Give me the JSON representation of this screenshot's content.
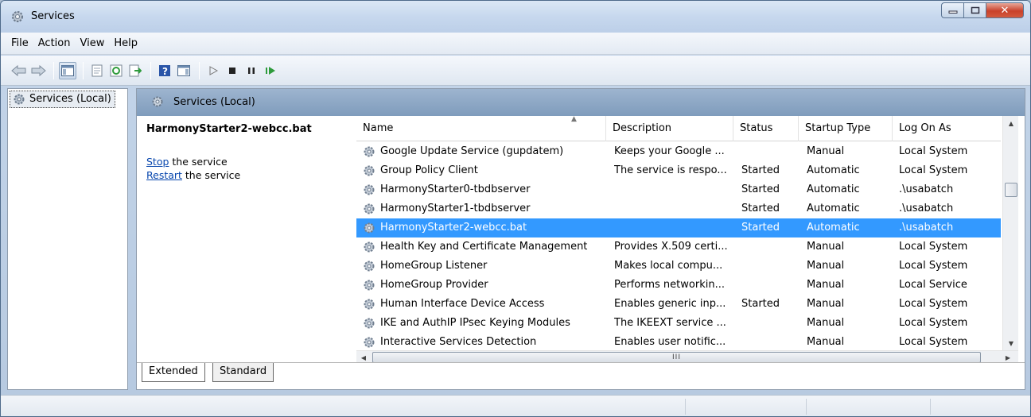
{
  "window": {
    "title": "Services"
  },
  "menu": [
    "File",
    "Action",
    "View",
    "Help"
  ],
  "toolbar": {
    "icons": [
      "back-arrow-icon",
      "forward-arrow-icon",
      "show-hide-console-tree-icon",
      "properties-icon",
      "refresh-icon",
      "export-list-icon",
      "help-icon",
      "show-hide-action-pane-icon",
      "start-service-icon",
      "stop-service-icon",
      "pause-service-icon",
      "restart-service-icon"
    ]
  },
  "tree": {
    "item_label": "Services (Local)"
  },
  "main": {
    "header_title": "Services (Local)",
    "selected_service": "HarmonyStarter2-webcc.bat",
    "stop_link": "Stop",
    "stop_suffix": " the service",
    "restart_link": "Restart",
    "restart_suffix": " the service"
  },
  "columns": [
    "Name",
    "Description",
    "Status",
    "Startup Type",
    "Log On As"
  ],
  "services": [
    {
      "name": "Google Update Service (gupdatem)",
      "description": "Keeps your Google ...",
      "status": "",
      "startup": "Manual",
      "logon": "Local System"
    },
    {
      "name": "Group Policy Client",
      "description": "The service is respo...",
      "status": "Started",
      "startup": "Automatic",
      "logon": "Local System"
    },
    {
      "name": "HarmonyStarter0-tbdbserver",
      "description": "",
      "status": "Started",
      "startup": "Automatic",
      "logon": ".\\usabatch"
    },
    {
      "name": "HarmonyStarter1-tbdbserver",
      "description": "",
      "status": "Started",
      "startup": "Automatic",
      "logon": ".\\usabatch"
    },
    {
      "name": "HarmonyStarter2-webcc.bat",
      "description": "",
      "status": "Started",
      "startup": "Automatic",
      "logon": ".\\usabatch",
      "selected": true
    },
    {
      "name": "Health Key and Certificate Management",
      "description": "Provides X.509 certi...",
      "status": "",
      "startup": "Manual",
      "logon": "Local System"
    },
    {
      "name": "HomeGroup Listener",
      "description": "Makes local compu...",
      "status": "",
      "startup": "Manual",
      "logon": "Local System"
    },
    {
      "name": "HomeGroup Provider",
      "description": "Performs networkin...",
      "status": "",
      "startup": "Manual",
      "logon": "Local Service"
    },
    {
      "name": "Human Interface Device Access",
      "description": "Enables generic inp...",
      "status": "Started",
      "startup": "Manual",
      "logon": "Local System"
    },
    {
      "name": "IKE and AuthIP IPsec Keying Modules",
      "description": "The IKEEXT service ...",
      "status": "",
      "startup": "Manual",
      "logon": "Local System"
    },
    {
      "name": "Interactive Services Detection",
      "description": "Enables user notific...",
      "status": "",
      "startup": "Manual",
      "logon": "Local System"
    }
  ],
  "hscroll_grip": "III",
  "tabs": {
    "extended": "Extended",
    "standard": "Standard"
  },
  "colors": {
    "selection": "#3399ff",
    "header": "#8aa6c6",
    "link": "#0645ad"
  }
}
